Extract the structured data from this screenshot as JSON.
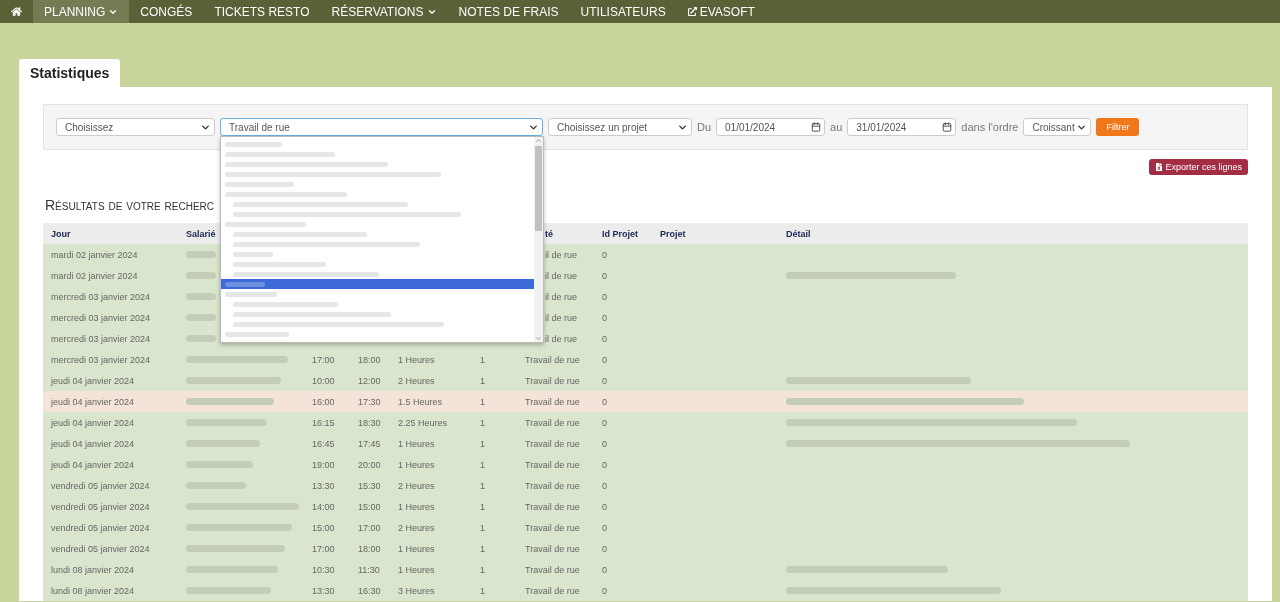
{
  "nav": {
    "items": [
      {
        "label": "PLANNING",
        "selected": true,
        "dropdown": true,
        "external": false
      },
      {
        "label": "CONGÉS",
        "selected": false,
        "dropdown": false,
        "external": false
      },
      {
        "label": "TICKETS RESTO",
        "selected": false,
        "dropdown": false,
        "external": false
      },
      {
        "label": "RÉSERVATIONS",
        "selected": false,
        "dropdown": true,
        "external": false
      },
      {
        "label": "NOTES DE FRAIS",
        "selected": false,
        "dropdown": false,
        "external": false
      },
      {
        "label": "UTILISATEURS",
        "selected": false,
        "dropdown": false,
        "external": false
      },
      {
        "label": "EVASOFT",
        "selected": false,
        "dropdown": false,
        "external": true
      }
    ]
  },
  "tabs": [
    {
      "label": "Statistiques",
      "selected": true
    }
  ],
  "filters": {
    "category_select": "Choisissez",
    "activity_select": "Travail de rue",
    "project_select": "Choisissez un projet",
    "from_label": "Du",
    "from_date": "01/01/2024",
    "to_label": "au",
    "to_date": "31/01/2024",
    "order_label": "dans l'ordre",
    "order_select": "Croissant",
    "filter_button": "Filtrer"
  },
  "activity_options": [
    {
      "selected": false
    },
    {
      "selected": false
    },
    {
      "selected": false
    },
    {
      "selected": false
    },
    {
      "selected": false
    },
    {
      "selected": false,
      "children": [
        {
          "selected": false
        },
        {
          "selected": false
        }
      ]
    },
    {
      "selected": false,
      "children": [
        {
          "selected": false
        },
        {
          "selected": false
        },
        {
          "selected": false
        },
        {
          "selected": false
        },
        {
          "selected": false
        }
      ]
    },
    {
      "selected": true
    },
    {
      "selected": false,
      "children": [
        {
          "selected": false
        },
        {
          "selected": false
        },
        {
          "selected": false
        }
      ]
    },
    {
      "selected": false
    }
  ],
  "export_button": "Exporter ces lignes",
  "results_heading": "Résultats de votre recherc",
  "table": {
    "columns": [
      {
        "label": "Jour"
      },
      {
        "label": "Salarié"
      },
      {},
      {},
      {},
      {},
      {
        "label": "té",
        "cut": true
      },
      {
        "label": "Id Projet"
      },
      {
        "label": "Projet"
      },
      {
        "label": "Détail"
      }
    ],
    "rows": [
      {
        "jour": "mardi 02 janvier 2024",
        "cut": true,
        "activity": "il de rue",
        "id_projet": "0",
        "detail_blurred": false,
        "highlight": false
      },
      {
        "jour": "mardi 02 janvier 2024",
        "cut": true,
        "activity": "il de rue",
        "id_projet": "0",
        "detail_blurred": true,
        "highlight": false
      },
      {
        "jour": "mercredi 03 janvier 2024",
        "cut": true,
        "activity": "il de rue",
        "id_projet": "0",
        "detail_blurred": false,
        "highlight": false
      },
      {
        "jour": "mercredi 03 janvier 2024",
        "cut": true,
        "activity": "il de rue",
        "id_projet": "0",
        "detail_blurred": false,
        "highlight": false
      },
      {
        "jour": "mercredi 03 janvier 2024",
        "cut": true,
        "activity": "il de rue",
        "id_projet": "0",
        "detail_blurred": false,
        "highlight": false
      },
      {
        "jour": "mercredi 03 janvier 2024",
        "cut": false,
        "start": "17:00",
        "end": "18:00",
        "duration": "1 Heures",
        "count": "1",
        "activity": "Travail de rue",
        "id_projet": "0",
        "detail_blurred": false,
        "highlight": false
      },
      {
        "jour": "jeudi 04 janvier 2024",
        "cut": false,
        "start": "10:00",
        "end": "12:00",
        "duration": "2 Heures",
        "count": "1",
        "activity": "Travail de rue",
        "id_projet": "0",
        "detail_blurred": true,
        "highlight": false
      },
      {
        "jour": "jeudi 04 janvier 2024",
        "cut": false,
        "start": "16:00",
        "end": "17:30",
        "duration": "1.5 Heures",
        "count": "1",
        "activity": "Travail de rue",
        "id_projet": "0",
        "detail_blurred": true,
        "highlight": true
      },
      {
        "jour": "jeudi 04 janvier 2024",
        "cut": false,
        "start": "16:15",
        "end": "18:30",
        "duration": "2.25 Heures",
        "count": "1",
        "activity": "Travail de rue",
        "id_projet": "0",
        "detail_blurred": true,
        "highlight": false
      },
      {
        "jour": "jeudi 04 janvier 2024",
        "cut": false,
        "start": "16:45",
        "end": "17:45",
        "duration": "1 Heures",
        "count": "1",
        "activity": "Travail de rue",
        "id_projet": "0",
        "detail_blurred": true,
        "highlight": false
      },
      {
        "jour": "jeudi 04 janvier 2024",
        "cut": false,
        "start": "19:00",
        "end": "20:00",
        "duration": "1 Heures",
        "count": "1",
        "activity": "Travail de rue",
        "id_projet": "0",
        "detail_blurred": false,
        "highlight": false
      },
      {
        "jour": "vendredi 05 janvier 2024",
        "cut": false,
        "start": "13:30",
        "end": "15:30",
        "duration": "2 Heures",
        "count": "1",
        "activity": "Travail de rue",
        "id_projet": "0",
        "detail_blurred": false,
        "highlight": false
      },
      {
        "jour": "vendredi 05 janvier 2024",
        "cut": false,
        "start": "14:00",
        "end": "15:00",
        "duration": "1 Heures",
        "count": "1",
        "activity": "Travail de rue",
        "id_projet": "0",
        "detail_blurred": false,
        "highlight": false
      },
      {
        "jour": "vendredi 05 janvier 2024",
        "cut": false,
        "start": "15:00",
        "end": "17:00",
        "duration": "2 Heures",
        "count": "1",
        "activity": "Travail de rue",
        "id_projet": "0",
        "detail_blurred": false,
        "highlight": false
      },
      {
        "jour": "vendredi 05 janvier 2024",
        "cut": false,
        "start": "17:00",
        "end": "18:00",
        "duration": "1 Heures",
        "count": "1",
        "activity": "Travail de rue",
        "id_projet": "0",
        "detail_blurred": false,
        "highlight": false
      },
      {
        "jour": "lundi 08 janvier 2024",
        "cut": false,
        "start": "10:30",
        "end": "11:30",
        "duration": "1 Heures",
        "count": "1",
        "activity": "Travail de rue",
        "id_projet": "0",
        "detail_blurred": true,
        "highlight": false
      },
      {
        "jour": "lundi 08 janvier 2024",
        "cut": false,
        "start": "13:30",
        "end": "16:30",
        "duration": "3 Heures",
        "count": "1",
        "activity": "Travail de rue",
        "id_projet": "0",
        "detail_blurred": true,
        "highlight": false
      }
    ]
  }
}
